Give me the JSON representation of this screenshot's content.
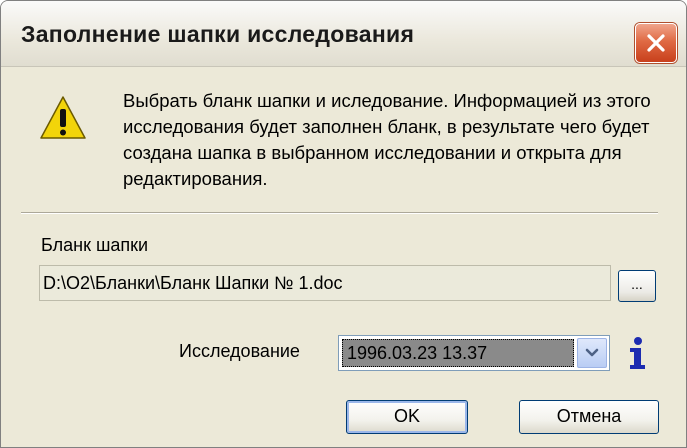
{
  "window": {
    "title": "Заполнение шапки исследования",
    "close_icon": "close-icon"
  },
  "message": {
    "icon": "warning-icon",
    "text": "Выбрать бланк шапки и иследование. Информацией из этого исследования будет заполнен бланк, в результате чего будет создана шапка в выбранном исследовании и открыта для редактирования."
  },
  "blank": {
    "label": "Бланк шапки",
    "path": "D:\\O2\\Бланки\\Бланк Шапки № 1.doc",
    "browse_label": "..."
  },
  "study": {
    "label": "Исследование",
    "selected": "1996.03.23 13.37",
    "dropdown_icon": "chevron-down-icon",
    "info_icon": "info-icon"
  },
  "buttons": {
    "ok": "OK",
    "cancel": "Отмена"
  },
  "colors": {
    "dialog_bg": "#ece9d8",
    "close_button": "#e06a44",
    "info_icon": "#1c2bb0",
    "warning_fill": "#f2d40a"
  }
}
